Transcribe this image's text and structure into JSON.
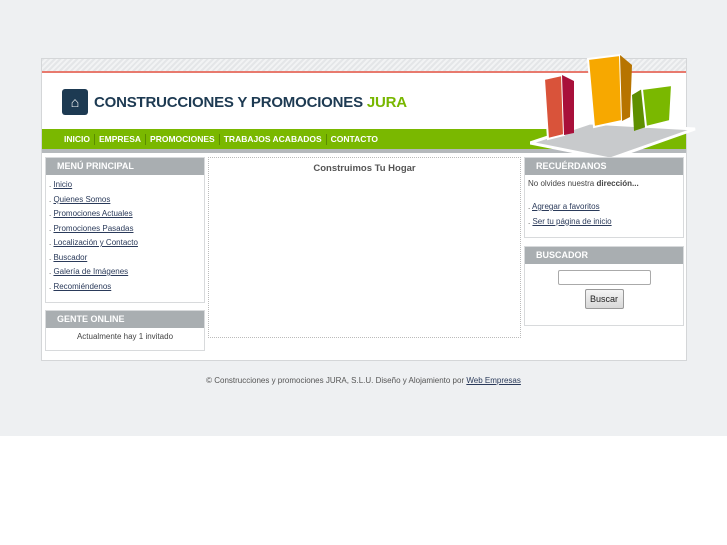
{
  "header": {
    "logo_text": "CONSTRUCCIONES Y PROMOCIONES",
    "logo_accent": "JURA"
  },
  "nav": [
    "INICIO",
    "EMPRESA",
    "PROMOCIONES",
    "TRABAJOS ACABADOS",
    "CONTACTO"
  ],
  "menu": {
    "title": "MENÚ PRINCIPAL",
    "items": [
      "Inicio",
      "Quienes Somos",
      "Promociones Actuales",
      "Promociones Pasadas",
      "Localización y Contacto",
      "Buscador",
      "Galería de Imágenes",
      "Recomiéndenos"
    ]
  },
  "online": {
    "title": "GENTE ONLINE",
    "text": "Actualmente hay 1 invitado"
  },
  "main": {
    "title": "Construimos Tu Hogar"
  },
  "remember": {
    "title": "RECUÉRDANOS",
    "text": "No olvides nuestra ",
    "bold": "dirección...",
    "links": [
      "Agregar a favoritos",
      "Ser tu página de inicio"
    ]
  },
  "search": {
    "title": "BUSCADOR",
    "button": "Buscar",
    "value": ""
  },
  "footer": {
    "text": "© Construcciones y promociones JURA, S.L.U. Diseño y Alojamiento por ",
    "link": "Web Empresas"
  }
}
